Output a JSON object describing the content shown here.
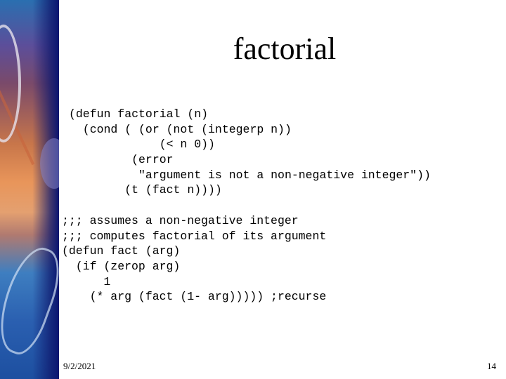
{
  "slide": {
    "title": "factorial",
    "code_block_1": [
      "(defun factorial (n)",
      "  (cond ( (or (not (integerp n))",
      "             (< n 0))",
      "         (error",
      "          \"argument is not a non-negative integer\"))",
      "        (t (fact n))))"
    ],
    "code_block_2": [
      ";;; assumes a non-negative integer",
      ";;; computes factorial of its argument",
      "(defun fact (arg)",
      "  (if (zerop arg)",
      "      1",
      "    (* arg (fact (1- arg))))) ;recurse"
    ],
    "footer": {
      "date": "9/2/2021",
      "page_number": "14"
    }
  }
}
